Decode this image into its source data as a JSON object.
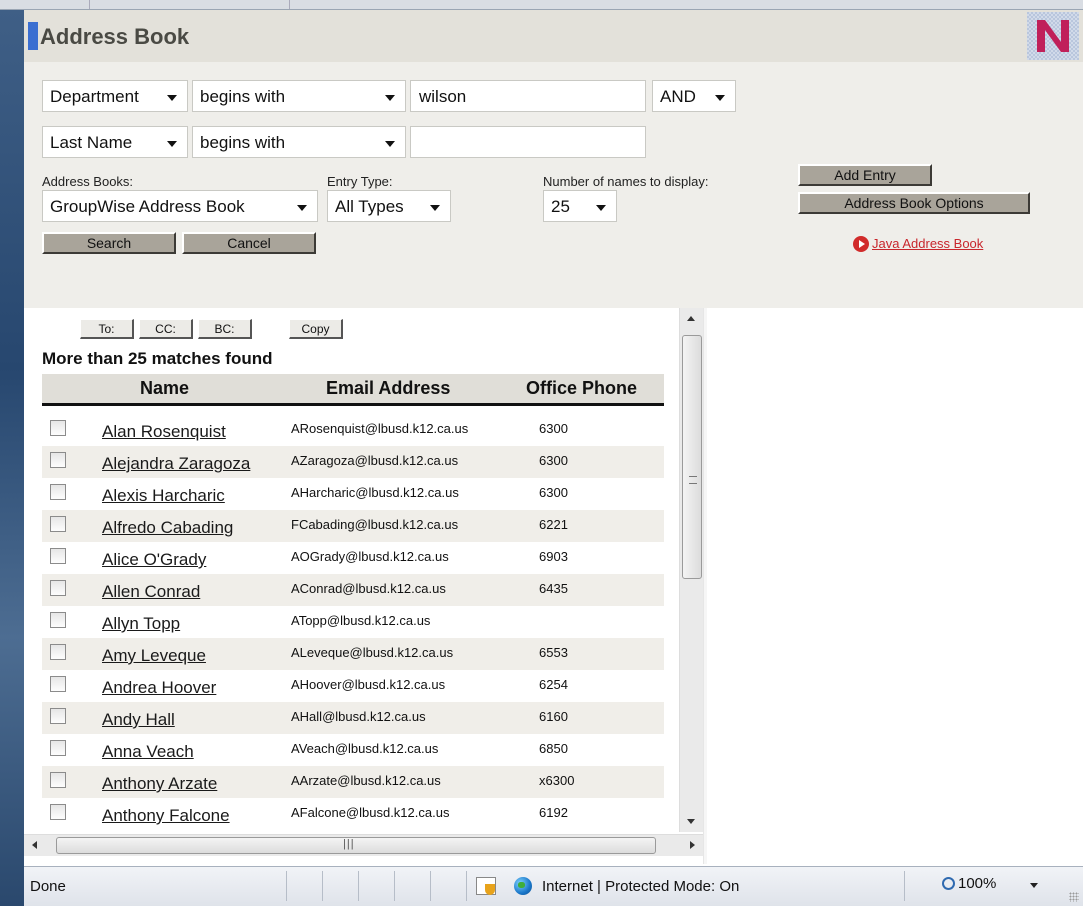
{
  "header": {
    "title": "Address Book",
    "logo_letter": "N"
  },
  "search": {
    "row1": {
      "field": "Department",
      "operator": "begins with",
      "value": "wilson",
      "conjunction": "AND"
    },
    "row2": {
      "field": "Last Name",
      "operator": "begins with",
      "value": ""
    },
    "address_books_label": "Address Books:",
    "address_book": "GroupWise Address Book",
    "entry_type_label": "Entry Type:",
    "entry_type": "All Types",
    "num_names_label": "Number of names to display:",
    "num_names": "25",
    "add_entry": "Add Entry",
    "options": "Address Book Options",
    "search_btn": "Search",
    "cancel_btn": "Cancel",
    "java_link": "Java Address Book"
  },
  "results": {
    "to_btn": "To:",
    "cc_btn": "CC:",
    "bc_btn": "BC:",
    "copy_btn": "Copy",
    "match_text": "More than 25 matches found",
    "columns": {
      "name": "Name",
      "email": "Email Address",
      "phone": "Office Phone"
    },
    "rows": [
      {
        "name": "Alan Rosenquist",
        "email": "ARosenquist@lbusd.k12.ca.us",
        "phone": "6300"
      },
      {
        "name": "Alejandra Zaragoza",
        "email": "AZaragoza@lbusd.k12.ca.us",
        "phone": "6300"
      },
      {
        "name": "Alexis Harcharic",
        "email": "AHarcharic@lbusd.k12.ca.us",
        "phone": "6300"
      },
      {
        "name": "Alfredo Cabading",
        "email": "FCabading@lbusd.k12.ca.us",
        "phone": "6221"
      },
      {
        "name": "Alice O'Grady",
        "email": "AOGrady@lbusd.k12.ca.us",
        "phone": "6903"
      },
      {
        "name": "Allen Conrad",
        "email": "AConrad@lbusd.k12.ca.us",
        "phone": "6435"
      },
      {
        "name": "Allyn Topp",
        "email": "ATopp@lbusd.k12.ca.us",
        "phone": ""
      },
      {
        "name": "Amy Leveque",
        "email": "ALeveque@lbusd.k12.ca.us",
        "phone": "6553"
      },
      {
        "name": "Andrea Hoover",
        "email": "AHoover@lbusd.k12.ca.us",
        "phone": "6254"
      },
      {
        "name": "Andy Hall",
        "email": "AHall@lbusd.k12.ca.us",
        "phone": "6160"
      },
      {
        "name": "Anna Veach",
        "email": "AVeach@lbusd.k12.ca.us",
        "phone": "6850"
      },
      {
        "name": "Anthony Arzate",
        "email": "AArzate@lbusd.k12.ca.us",
        "phone": "x6300"
      },
      {
        "name": "Anthony Falcone",
        "email": "AFalcone@lbusd.k12.ca.us",
        "phone": "6192"
      }
    ]
  },
  "status": {
    "text": "Done",
    "zone": "Internet | Protected Mode: On",
    "zoom": "100%"
  },
  "colors": {
    "accent": "#3b6fd1",
    "link_red": "#c8262c",
    "button": "#a9a49a"
  }
}
